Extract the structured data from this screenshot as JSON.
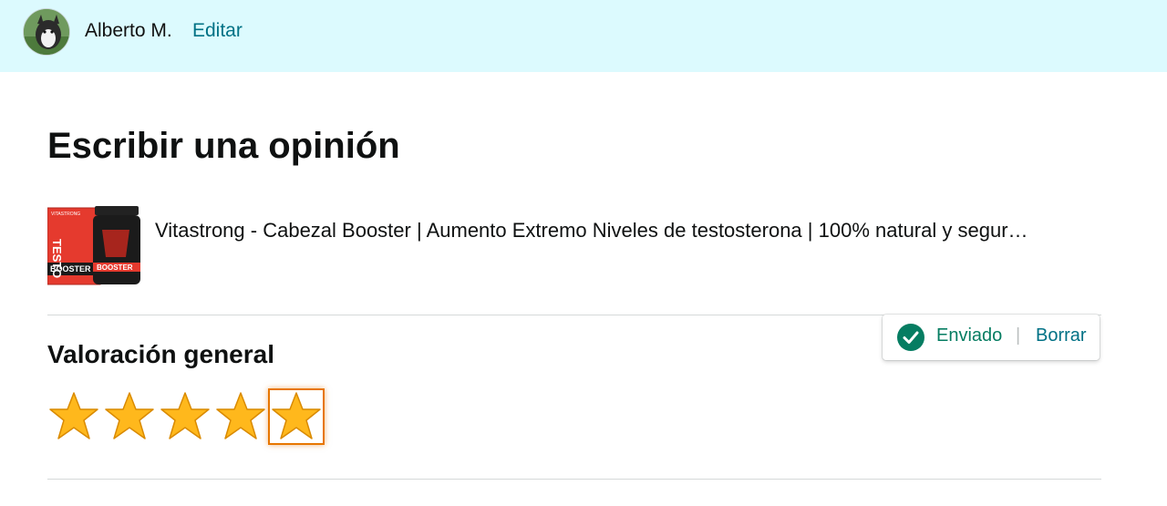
{
  "header": {
    "user_name": "Alberto M.",
    "edit_label": "Editar"
  },
  "page": {
    "title": "Escribir una opinión"
  },
  "product": {
    "title": "Vitastrong - Cabezal Booster | Aumento Extremo Niveles de testosterona | 100% natural y segur…",
    "image_text_top": "TESTO",
    "image_text_bottom": "BOOSTER",
    "image_brand": "VITASTRONG"
  },
  "rating": {
    "section_title": "Valoración general",
    "value": 5,
    "max": 5
  },
  "status": {
    "sent_label": "Enviado",
    "separator": "|",
    "delete_label": "Borrar"
  },
  "colors": {
    "header_bg": "#dcfafe",
    "link": "#007185",
    "success": "#067d62",
    "star": "#ffa41c",
    "focus": "#e77600"
  }
}
